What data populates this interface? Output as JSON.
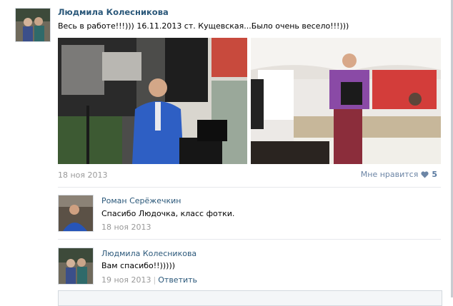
{
  "post": {
    "author": "Людмила Колесникова",
    "text": "Весь в работе!!!))) 16.11.2013 ст. Кущевская...Было очень весело!!!)))",
    "date": "18 ноя 2013",
    "like_label": "Мне нравится",
    "like_count": "5",
    "photos": [
      "photo-dj-blue-suit",
      "photo-host-microphone"
    ]
  },
  "comments": [
    {
      "author": "Роман Серёжечкин",
      "text": "Спасибо Людочка, класс фотки.",
      "date": "18 ноя 2013"
    },
    {
      "author": "Людмила Колесникова",
      "text": "Вам спасибо!!)))))",
      "date": "19 ноя 2013",
      "reply_label": "Ответить"
    }
  ],
  "colors": {
    "link": "#2b587a",
    "date": "#999999",
    "like_heart": "#6c85a5"
  }
}
